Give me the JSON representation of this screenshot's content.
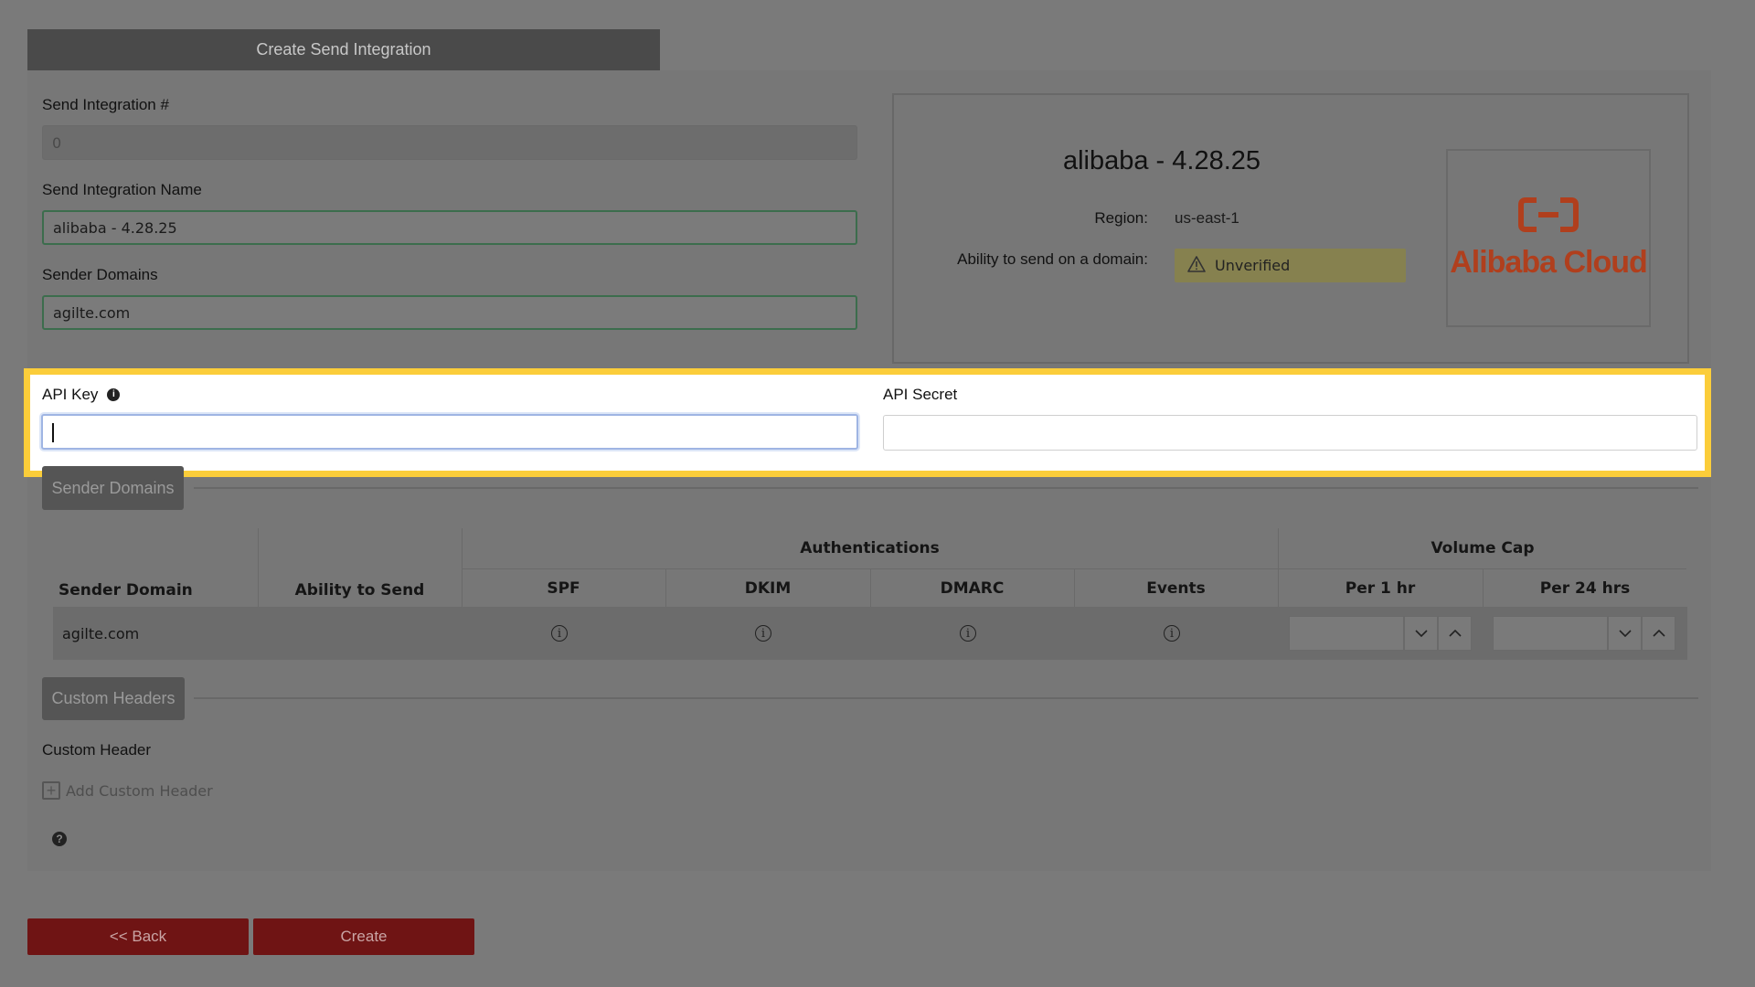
{
  "tab_title": "Create Send Integration",
  "form": {
    "send_integration_number_label": "Send Integration #",
    "send_integration_number_value": "0",
    "send_integration_name_label": "Send Integration Name",
    "send_integration_name_value": "alibaba - 4.28.25",
    "sender_domains_label": "Sender Domains",
    "sender_domains_value": "agilte.com",
    "api_key_label": "API Key",
    "api_key_value": "",
    "api_secret_label": "API Secret",
    "api_secret_value": ""
  },
  "card": {
    "title": "alibaba - 4.28.25",
    "region_label": "Region:",
    "region_value": "us-east-1",
    "ability_label": "Ability to send on a domain:",
    "status": "Unverified",
    "logo_text": "Alibaba Cloud",
    "logo_color": "#b03f1d"
  },
  "sender_domains_section": {
    "title": "Sender Domains",
    "headers": {
      "sender_domain": "Sender Domain",
      "ability_to_send": "Ability to Send",
      "authentications": "Authentications",
      "spf": "SPF",
      "dkim": "DKIM",
      "dmarc": "DMARC",
      "events": "Events",
      "volume_cap": "Volume Cap",
      "per_1_hr": "Per 1 hr",
      "per_24_hrs": "Per 24 hrs"
    },
    "rows": [
      {
        "domain": "agilte.com"
      }
    ]
  },
  "custom_headers_section": {
    "title": "Custom Headers",
    "label": "Custom Header",
    "add_label": "Add Custom Header"
  },
  "buttons": {
    "back": "<< Back",
    "create": "Create"
  },
  "colors": {
    "highlight": "#fbcd3a",
    "primary_button": "#6f1414"
  }
}
